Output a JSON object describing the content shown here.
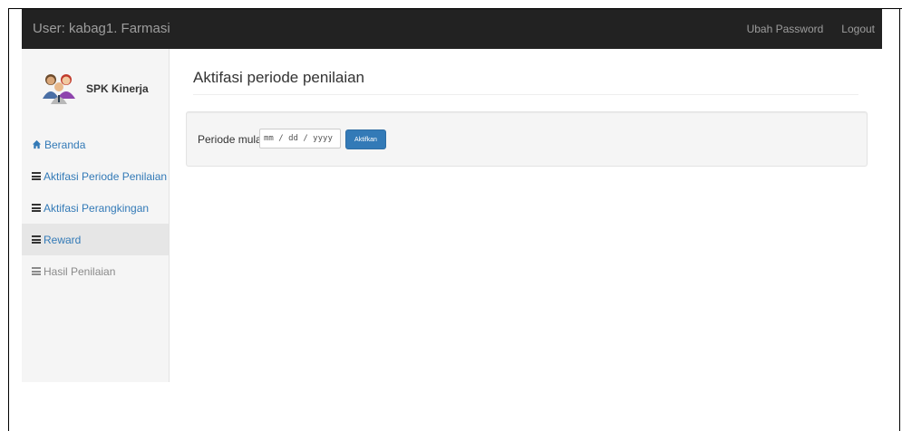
{
  "navbar": {
    "user_label": "User: kabag1. Farmasi",
    "links": [
      "Ubah Password",
      "Logout"
    ]
  },
  "sidebar": {
    "app_name": "SPK Kinerja",
    "items": [
      {
        "label": "Beranda",
        "icon": "home-icon"
      },
      {
        "label": "Aktifasi Periode Penilaian",
        "icon": "list-icon"
      },
      {
        "label": "Aktifasi Perangkingan",
        "icon": "list-icon"
      },
      {
        "label": "Reward",
        "icon": "list-icon"
      },
      {
        "label": "Hasil Penilaian",
        "icon": "list-icon"
      }
    ]
  },
  "main": {
    "title": "Aktifasi periode penilaian",
    "form": {
      "label": "Periode mulai:",
      "date_placeholder": "mm / dd / yyyy",
      "submit_label": "Aktifkan"
    }
  },
  "colors": {
    "navbar_bg": "#222222",
    "link": "#337ab7",
    "primary_button": "#337ab7"
  }
}
